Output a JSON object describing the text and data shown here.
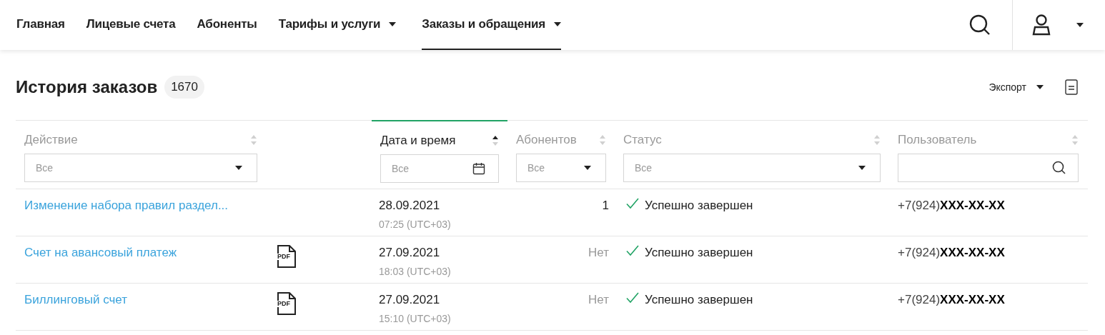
{
  "nav": {
    "items": [
      {
        "label": "Главная",
        "selected": false,
        "dropdown": false
      },
      {
        "label": "Лицевые счета",
        "selected": false,
        "dropdown": false
      },
      {
        "label": "Абоненты",
        "selected": false,
        "dropdown": false
      },
      {
        "label": "Тарифы и услуги",
        "selected": false,
        "dropdown": true
      },
      {
        "label": "Заказы и обращения",
        "selected": true,
        "dropdown": true
      }
    ]
  },
  "page": {
    "title": "История заказов",
    "count": "1670",
    "export": "Экспорт"
  },
  "table": {
    "columns": [
      {
        "label": "Действие",
        "sorted": false,
        "filter": {
          "kind": "select",
          "value": "Все"
        }
      },
      {
        "label": "Дата и время",
        "sorted": true,
        "filter": {
          "kind": "date",
          "value": "Все"
        }
      },
      {
        "label": "Абонентов",
        "sorted": false,
        "filter": {
          "kind": "select",
          "value": "Все"
        }
      },
      {
        "label": "Статус",
        "sorted": false,
        "filter": {
          "kind": "select",
          "value": "Все"
        }
      },
      {
        "label": "Пользователь",
        "sorted": false,
        "filter": {
          "kind": "search"
        }
      }
    ],
    "rows": [
      {
        "action": "Изменение набора правил раздел...",
        "file": null,
        "date": "28.09.2021",
        "time": "07:25 (UTC+03)",
        "subscribers": "1",
        "subscribers_empty": false,
        "status": "Успешно завершен",
        "status_ok": true,
        "phone_prefix": "+7(924)",
        "phone_masked": "XXX-XX-XX"
      },
      {
        "action": "Счет на авансовый платеж",
        "file": "PDF",
        "date": "27.09.2021",
        "time": "18:03 (UTC+03)",
        "subscribers": "Нет",
        "subscribers_empty": true,
        "status": "Успешно завершен",
        "status_ok": true,
        "phone_prefix": "+7(924)",
        "phone_masked": "XXX-XX-XX"
      },
      {
        "action": "Биллинговый счет",
        "file": "PDF",
        "date": "27.09.2021",
        "time": "15:10 (UTC+03)",
        "subscribers": "Нет",
        "subscribers_empty": true,
        "status": "Успешно завершен",
        "status_ok": true,
        "phone_prefix": "+7(924)",
        "phone_masked": "XXX-XX-XX"
      }
    ]
  }
}
